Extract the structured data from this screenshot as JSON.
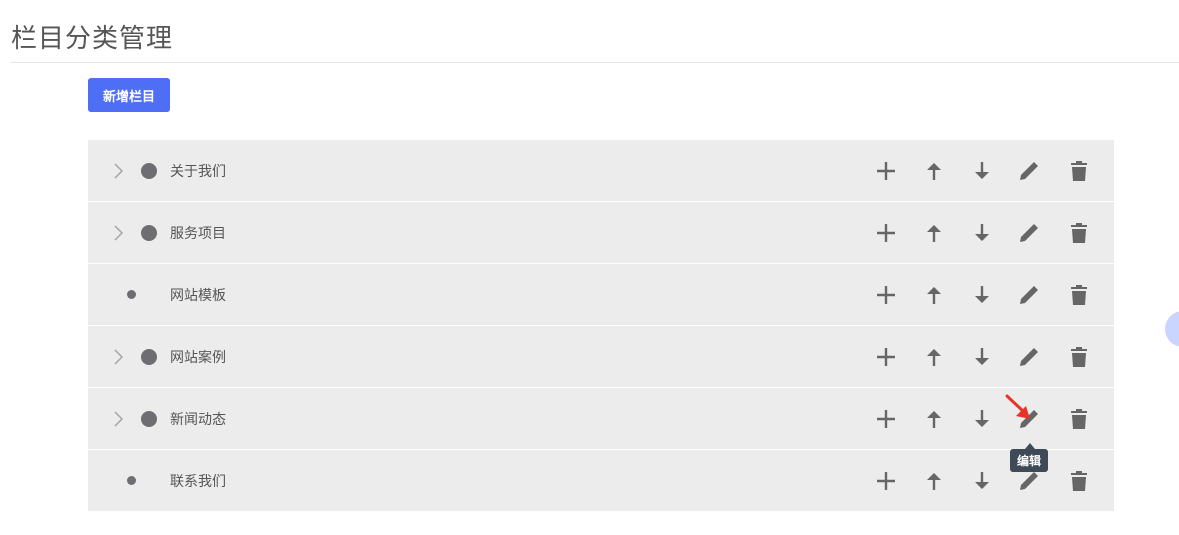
{
  "page": {
    "title": "栏目分类管理"
  },
  "toolbar": {
    "add_label": "新增栏目"
  },
  "tree": {
    "rows": [
      {
        "label": "关于我们",
        "has_children": true
      },
      {
        "label": "服务项目",
        "has_children": true
      },
      {
        "label": "网站模板",
        "has_children": false
      },
      {
        "label": "网站案例",
        "has_children": true
      },
      {
        "label": "新闻动态",
        "has_children": true
      },
      {
        "label": "联系我们",
        "has_children": false
      }
    ]
  },
  "actions": {
    "icons": [
      "plus-icon",
      "arrow-up-icon",
      "arrow-down-icon",
      "pencil-icon",
      "trash-icon"
    ]
  },
  "tooltip": {
    "text": "编辑"
  },
  "colors": {
    "primary": "#4d6ef5",
    "row_bg": "#ececec",
    "icon": "#666666",
    "tooltip_bg": "#3f4a57",
    "pointer": "#e8332a"
  }
}
